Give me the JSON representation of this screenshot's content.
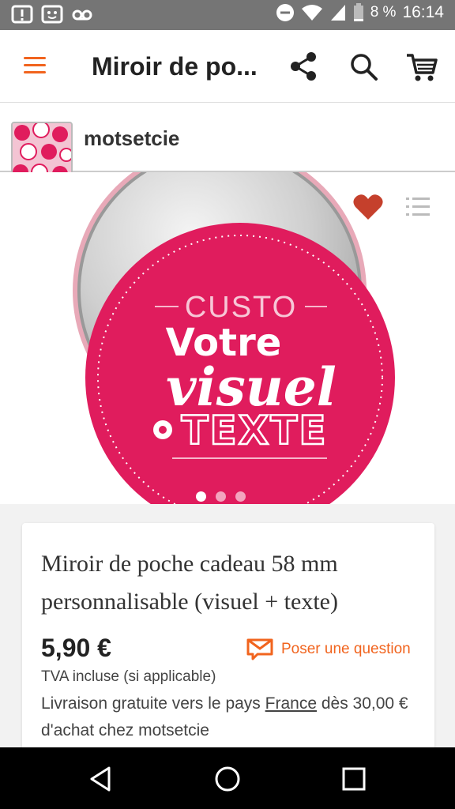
{
  "status_bar": {
    "battery_pct": "8 %",
    "time": "16:14"
  },
  "app_bar": {
    "title": "Miroir de po..."
  },
  "shop": {
    "name": "motsetcie"
  },
  "hero": {
    "image_text": {
      "line1": "CUSTO",
      "line2": "Votre",
      "line3": "visuel",
      "line4": "TEXTE"
    },
    "dots": [
      {
        "active": true
      },
      {
        "active": false
      },
      {
        "active": false
      }
    ]
  },
  "product": {
    "title": "Miroir de poche cadeau 58 mm personnalisable (visuel + texte)",
    "price": "5,90 €",
    "tax_note": "TVA incluse (si applicable)",
    "ask_label": "Poser une question",
    "shipping_pre": "Livraison gratuite vers le pays ",
    "shipping_link": "France",
    "shipping_post": " dès 30,00 € d'achat chez motsetcie"
  },
  "colors": {
    "accent": "#f1641e",
    "badge_pink": "#e01c5d",
    "status_bar": "#757575"
  }
}
